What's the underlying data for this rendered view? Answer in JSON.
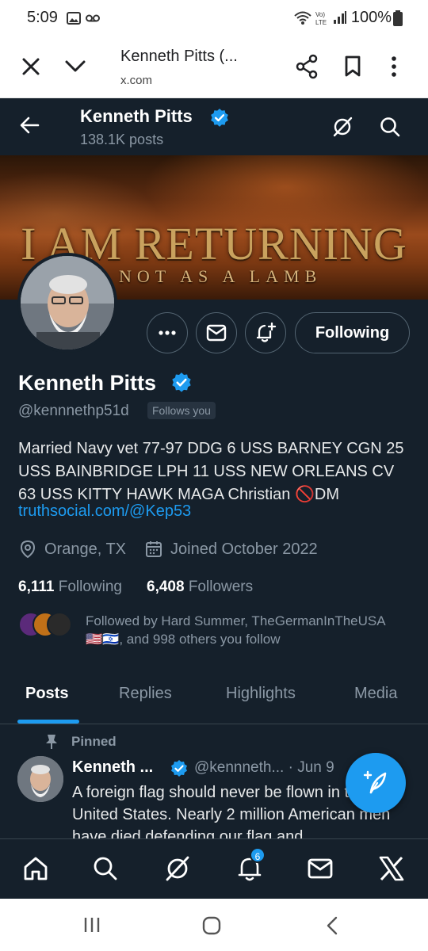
{
  "status_bar": {
    "time": "5:09",
    "battery": "100%",
    "icons": [
      "gallery-icon",
      "voicemail-icon",
      "wifi-icon",
      "volte-icon",
      "signal-icon",
      "battery-icon"
    ]
  },
  "browser": {
    "title": "Kenneth Pitts (...",
    "url": "x.com",
    "icons": [
      "close-icon",
      "chevron-down-icon",
      "share-icon",
      "bookmark-icon",
      "more-vert-icon"
    ]
  },
  "header": {
    "name": "Kenneth Pitts",
    "posts_count": "138.1K posts"
  },
  "banner": {
    "line1": "I AM RETURNING",
    "line2": "NOT AS A LAMB"
  },
  "profile": {
    "name": "Kenneth Pitts",
    "handle": "@kennnethp51d",
    "follows_you": "Follows you",
    "bio": "Married Navy vet 77-97  DDG 6 USS BARNEY CGN 25 USS BAINBRIDGE  LPH 11 USS NEW ORLEANS CV 63 USS KITTY HAWK MAGA Christian 🚫DM",
    "link": "truthsocial.com/@Kep53",
    "location": "Orange, TX",
    "joined": "Joined October 2022",
    "following_count": "6,111",
    "following_label": "Following",
    "followers_count": "6,408",
    "followers_label": "Followers",
    "followed_by_line1": "Followed by Hard Summer, TheGermanInTheUSA",
    "followed_by_flags": "🇺🇸🇮🇱",
    "followed_by_line2": ", and 998 others you follow",
    "following_button": "Following"
  },
  "tabs": [
    {
      "label": "Posts",
      "active": true
    },
    {
      "label": "Replies",
      "active": false
    },
    {
      "label": "Highlights",
      "active": false
    },
    {
      "label": "Media",
      "active": false
    }
  ],
  "pinned_post": {
    "pinned_label": "Pinned",
    "name": "Kenneth ...",
    "handle_date": "@kennneth... · Jun 9",
    "text": "A foreign flag should never be flown in the United States. Nearly 2 million American men have died defending our flag and"
  },
  "bottom_nav": {
    "notification_count": "6",
    "items": [
      "home-icon",
      "search-icon",
      "grok-icon",
      "notifications-icon",
      "messages-icon",
      "x-logo-icon"
    ]
  },
  "colors": {
    "bg": "#15202b",
    "accent": "#1d9bf0",
    "muted": "#8b98a5",
    "border": "#536471"
  }
}
